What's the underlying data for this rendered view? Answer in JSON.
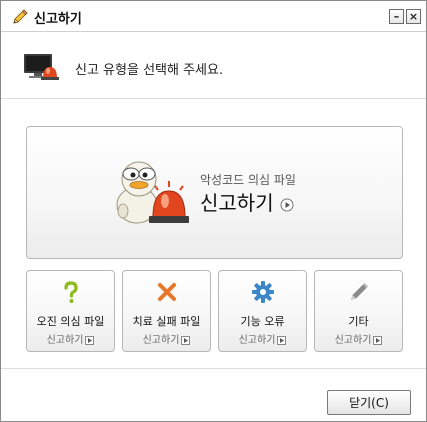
{
  "window": {
    "title": "신고하기",
    "minimize_label": "–",
    "close_label": "×"
  },
  "header": {
    "instruction": "신고 유형을 선택해 주세요."
  },
  "main_option": {
    "subtitle": "악성코드 의심 파일",
    "action": "신고하기"
  },
  "options": [
    {
      "label": "오진 의심 파일",
      "action": "신고하기",
      "icon": "question-icon",
      "color": "#8dbb1e"
    },
    {
      "label": "치료 실패 파일",
      "action": "신고하기",
      "icon": "x-icon",
      "color": "#e8772a"
    },
    {
      "label": "기능 오류",
      "action": "신고하기",
      "icon": "gear-icon",
      "color": "#3a86c8"
    },
    {
      "label": "기타",
      "action": "신고하기",
      "icon": "pencil-icon",
      "color": "#8a8a8a"
    }
  ],
  "footer": {
    "close_button": "닫기(C)"
  }
}
